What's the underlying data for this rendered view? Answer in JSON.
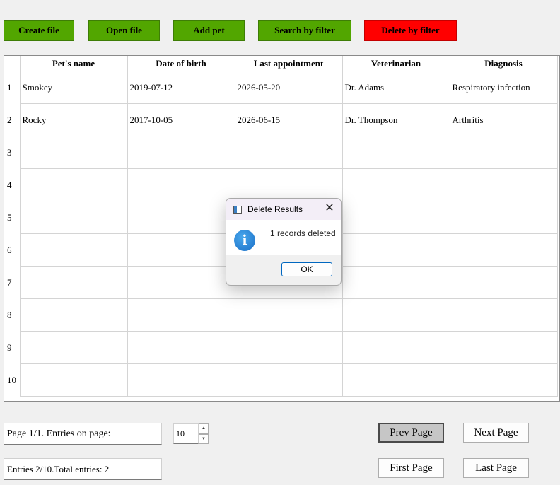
{
  "toolbar": {
    "create_file": "Create file",
    "open_file": "Open file",
    "add_pet": "Add pet",
    "search_by_filter": "Search by filter",
    "delete_by_filter": "Delete by filter"
  },
  "table": {
    "columns": [
      "Pet's name",
      "Date of birth",
      "Last appointment",
      "Veterinarian",
      "Diagnosis"
    ],
    "rows": [
      {
        "num": "1",
        "cells": [
          "Smokey",
          "2019-07-12",
          "2026-05-20",
          "Dr. Adams",
          "Respiratory infection"
        ]
      },
      {
        "num": "2",
        "cells": [
          "Rocky",
          "2017-10-05",
          "2026-06-15",
          "Dr. Thompson",
          "Arthritis"
        ]
      },
      {
        "num": "3",
        "cells": [
          "",
          "",
          "",
          "",
          ""
        ]
      },
      {
        "num": "4",
        "cells": [
          "",
          "",
          "",
          "",
          ""
        ]
      },
      {
        "num": "5",
        "cells": [
          "",
          "",
          "",
          "",
          ""
        ]
      },
      {
        "num": "6",
        "cells": [
          "",
          "",
          "",
          "",
          ""
        ]
      },
      {
        "num": "7",
        "cells": [
          "",
          "",
          "",
          "",
          ""
        ]
      },
      {
        "num": "8",
        "cells": [
          "",
          "",
          "",
          "",
          ""
        ]
      },
      {
        "num": "9",
        "cells": [
          "",
          "",
          "",
          "",
          ""
        ]
      },
      {
        "num": "10",
        "cells": [
          "",
          "",
          "",
          "",
          ""
        ]
      }
    ]
  },
  "pagination": {
    "page_info": "Page 1/1. Entries on page:",
    "entries_per_page": "10",
    "entries_info": "Entries 2/10.Total entries: 2",
    "prev_page": "Prev Page",
    "next_page": "Next Page",
    "first_page": "First Page",
    "last_page": "Last Page"
  },
  "dialog": {
    "title": "Delete Results",
    "message": "1 records deleted",
    "ok": "OK",
    "close_glyph": "✕",
    "info_glyph": "i"
  },
  "colors": {
    "button_green": "#52a600",
    "button_red": "#ff0000"
  }
}
